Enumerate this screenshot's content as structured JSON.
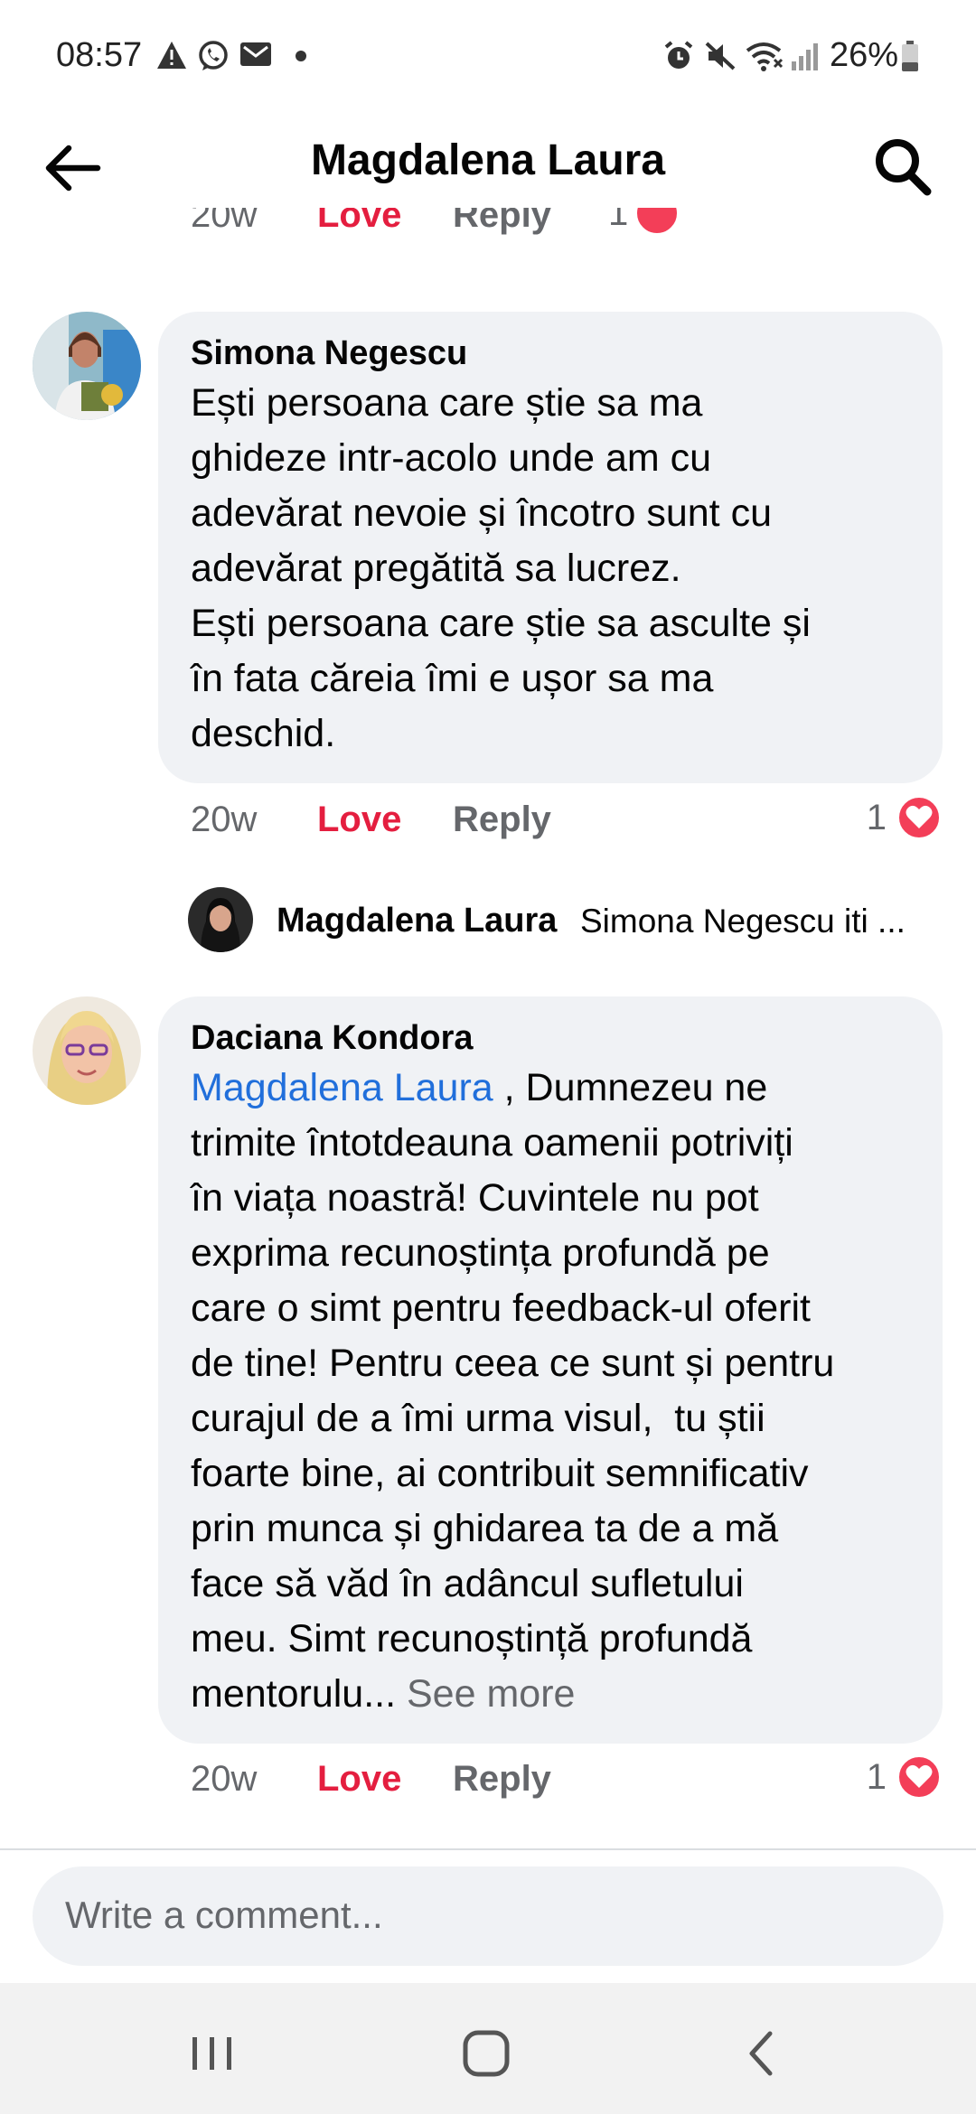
{
  "status_bar": {
    "time": "08:57",
    "battery": "26%",
    "left_icons": [
      "warning-icon",
      "whatsapp-icon",
      "mail-icon",
      "dot-icon"
    ],
    "right_icons": [
      "alarm-icon",
      "mute-icon",
      "wifi-icon",
      "signal-icon",
      "battery-icon"
    ]
  },
  "header": {
    "title": "Magdalena Laura"
  },
  "clipped_row": {
    "time": "20w",
    "love": "Love",
    "reply": "Reply",
    "count": "1"
  },
  "comments": [
    {
      "author": "Simona Negescu",
      "lines": [
        "Ești persoana care știe sa ma",
        "ghideze intr-acolo unde am cu",
        "adevărat nevoie și încotro sunt cu",
        "adevărat pregătită sa lucrez.",
        "Ești persoana care știe sa asculte și",
        "în fata căreia îmi e ușor sa ma",
        "deschid."
      ],
      "time": "20w",
      "love": "Love",
      "reply": "Reply",
      "reaction_count": "1"
    },
    {
      "author": "Daciana Kondora",
      "mention": "Magdalena Laura",
      "first_line_rest": " , Dumnezeu ne",
      "lines": [
        "trimite întotdeauna oamenii potriviți",
        "în viața noastră! Cuvintele nu pot",
        "exprima recunoștința profundă pe",
        "care o simt pentru feedback-ul oferit",
        "de tine! Pentru ceea ce sunt și pentru",
        "curajul de a îmi urma visul,  tu știi",
        "foarte bine, ai contribuit semnificativ",
        "prin munca și ghidarea ta de a mă",
        "face să văd în adâncul sufletului",
        "meu. Simt recunoștință profundă"
      ],
      "last_line": "mentorulu... ",
      "see_more": "See more",
      "time": "20w",
      "love": "Love",
      "reply": "Reply",
      "reaction_count": "1"
    }
  ],
  "reply_preview": {
    "author": "Magdalena Laura",
    "snippet": "Simona Negescu iti ..."
  },
  "composer": {
    "placeholder": "Write a comment..."
  },
  "colors": {
    "love": "#e41e3f",
    "mention": "#216fdb",
    "bubble": "#f0f2f5",
    "secondary_text": "#65676b"
  }
}
